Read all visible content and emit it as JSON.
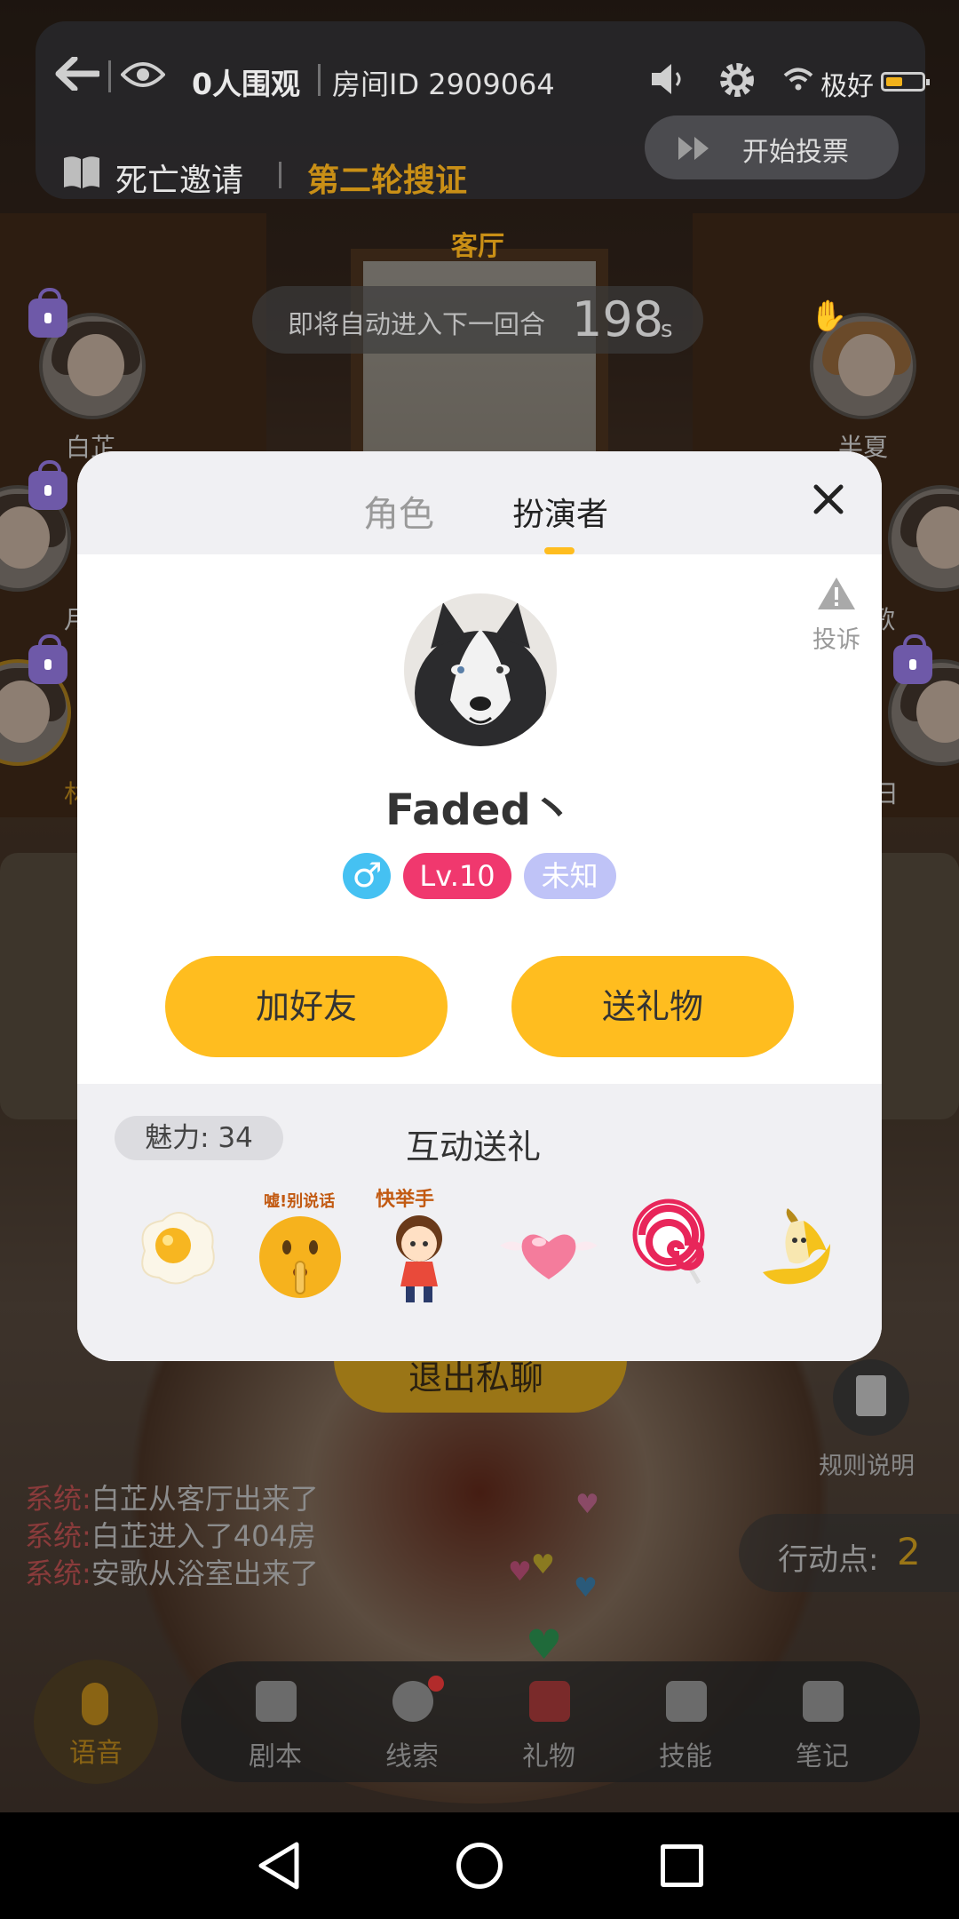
{
  "topbar": {
    "watchers": "0人围观",
    "room_id": "房间ID 2909064",
    "signal": "极好",
    "script_name": "死亡邀请",
    "round": "第二轮搜证",
    "vote_button": "开始投票"
  },
  "scene": {
    "location": "客厅",
    "timer_text": "即将自动进入下一回合",
    "timer_value": "198",
    "timer_unit": "s"
  },
  "players": {
    "left_top_name": "白芷",
    "left_mid_name": "月",
    "left_bottom_name": "林",
    "right_top_name": "半夏",
    "right_mid_name": "歌",
    "right_bottom_name": "日"
  },
  "modal": {
    "tabs": [
      "角色",
      "扮演者"
    ],
    "active_tab": "扮演者",
    "report_label": "投诉",
    "username": "Faded丶",
    "gender_symbol": "♂",
    "level": "Lv.10",
    "status_badge": "未知",
    "add_friend": "加好友",
    "send_gift": "送礼物",
    "charm": "魅力: 34",
    "interact_title": "互动送礼",
    "gifts": [
      {
        "name": "fried-egg",
        "caption": ""
      },
      {
        "name": "shush-emoji",
        "caption": "嘘!别说话"
      },
      {
        "name": "cartoon-girl",
        "caption": "快举手"
      },
      {
        "name": "winged-heart",
        "caption": ""
      },
      {
        "name": "lollipop",
        "caption": ""
      },
      {
        "name": "banana",
        "caption": ""
      }
    ]
  },
  "under_modal": {
    "exit_button": "退出私聊",
    "rules_label": "规则说明",
    "action_points_label": "行动点:",
    "action_points_value": "2"
  },
  "chat": [
    {
      "prefix": "系统:",
      "text": "白芷从客厅出来了"
    },
    {
      "prefix": "系统:",
      "text": "白芷进入了404房"
    },
    {
      "prefix": "系统:",
      "text": "安歌从浴室出来了"
    }
  ],
  "dock": {
    "voice": "语音",
    "items": [
      "剧本",
      "线索",
      "礼物",
      "技能",
      "笔记"
    ]
  },
  "colors": {
    "accent": "#ffbd1f",
    "level_badge": "#f0386e",
    "gender_badge": "#45c1f2",
    "unknown_badge": "#bfc3f7",
    "system_prefix": "#8a3b3b"
  }
}
